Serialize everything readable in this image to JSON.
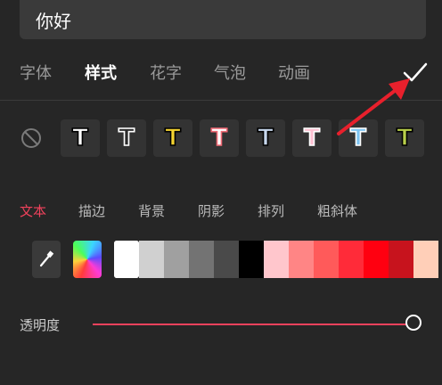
{
  "input": {
    "value": "你好"
  },
  "tabs": [
    {
      "label": "字体",
      "active": false
    },
    {
      "label": "样式",
      "active": true
    },
    {
      "label": "花字",
      "active": false
    },
    {
      "label": "气泡",
      "active": false
    },
    {
      "label": "动画",
      "active": false
    }
  ],
  "icons": {
    "confirm": "checkmark-icon",
    "none": "no-style-icon",
    "picker": "eyedropper-icon",
    "annotation": "red-arrow-icon"
  },
  "style_presets": [
    {
      "glyph": "T",
      "fill": "#ffffff",
      "stroke": "#000000"
    },
    {
      "glyph": "T",
      "fill": "#2a2a2a",
      "stroke": "#ffffff"
    },
    {
      "glyph": "T",
      "fill": "#f5d431",
      "stroke": "#000000"
    },
    {
      "glyph": "T",
      "fill": "#ffffff",
      "stroke": "#f06a75"
    },
    {
      "glyph": "T",
      "fill": "#c6d6ec",
      "stroke": "#000000"
    },
    {
      "glyph": "T",
      "fill": "#ffc0d2",
      "stroke": "#ffffff"
    },
    {
      "glyph": "T",
      "fill": "#7cc4f2",
      "stroke": "#ffffff"
    },
    {
      "glyph": "T",
      "fill": "#b8cf4a",
      "stroke": "#000000"
    }
  ],
  "subtabs": [
    {
      "label": "文本",
      "active": true
    },
    {
      "label": "描边",
      "active": false
    },
    {
      "label": "背景",
      "active": false
    },
    {
      "label": "阴影",
      "active": false
    },
    {
      "label": "排列",
      "active": false
    },
    {
      "label": "粗斜体",
      "active": false
    }
  ],
  "swatches": [
    "#ffffff",
    "#d0d0d0",
    "#a0a0a0",
    "#737373",
    "#4a4a4a",
    "#000000",
    "#ffc6cc",
    "#ff8585",
    "#ff5a5a",
    "#ff2b39",
    "#ff0010",
    "#c7131d",
    "#ffcfb8"
  ],
  "selected_swatch": 0,
  "opacity": {
    "label": "透明度",
    "value": 1.0
  },
  "colors": {
    "accent": "#f0425c",
    "background": "#262626",
    "arrow": "#e8202c"
  }
}
